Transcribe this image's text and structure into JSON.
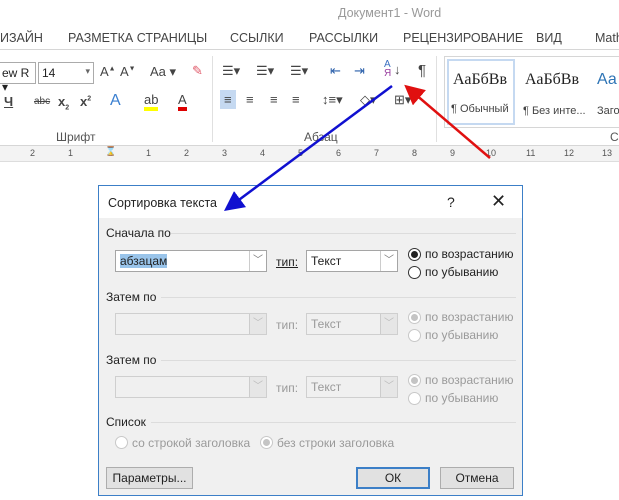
{
  "window": {
    "title": "Документ1 - Word"
  },
  "ribbon_tabs": [
    "ИЗАЙН",
    "РАЗМЕТКА СТРАНИЦЫ",
    "ССЫЛКИ",
    "РАССЫЛКИ",
    "РЕЦЕНЗИРОВАНИЕ",
    "ВИД",
    "MathT"
  ],
  "font_group": {
    "label": "Шрифт",
    "font_name": "ew R",
    "font_size": "14"
  },
  "paragraph_group": {
    "label": "Абзац"
  },
  "styles_group": {
    "styles": [
      {
        "preview": "АаБбВв",
        "name": "¶ Обычный"
      },
      {
        "preview": "АаБбВв",
        "name": "¶ Без инте..."
      },
      {
        "preview": "Аа",
        "name": "Заго"
      }
    ],
    "label": "С"
  },
  "ruler": {
    "left": [
      "2",
      "1"
    ],
    "right": [
      "1",
      "2",
      "3",
      "4",
      "5",
      "6",
      "7",
      "8",
      "9",
      "10",
      "11",
      "12",
      "13"
    ]
  },
  "arrows": {
    "blue": "#1010d0",
    "red": "#e01010"
  },
  "dialog": {
    "title": "Сортировка текста",
    "help": "?",
    "close": "✕",
    "first": {
      "label": "Сначала по",
      "field": "абзацам",
      "type_label": "тип:",
      "type": "Текст",
      "asc": "по возрастанию",
      "desc": "по убыванию"
    },
    "then1": {
      "label": "Затем по",
      "field": "",
      "type_label": "тип:",
      "type": "Текст",
      "asc": "по возрастанию",
      "desc": "по убыванию"
    },
    "then2": {
      "label": "Затем по",
      "field": "",
      "type_label": "тип:",
      "type": "Текст",
      "asc": "по возрастанию",
      "desc": "по убыванию"
    },
    "list": {
      "label": "Список",
      "with_header": "со строкой заголовка",
      "without_header": "без строки заголовка"
    },
    "buttons": {
      "options": "Параметры...",
      "ok": "ОК",
      "cancel": "Отмена"
    }
  }
}
